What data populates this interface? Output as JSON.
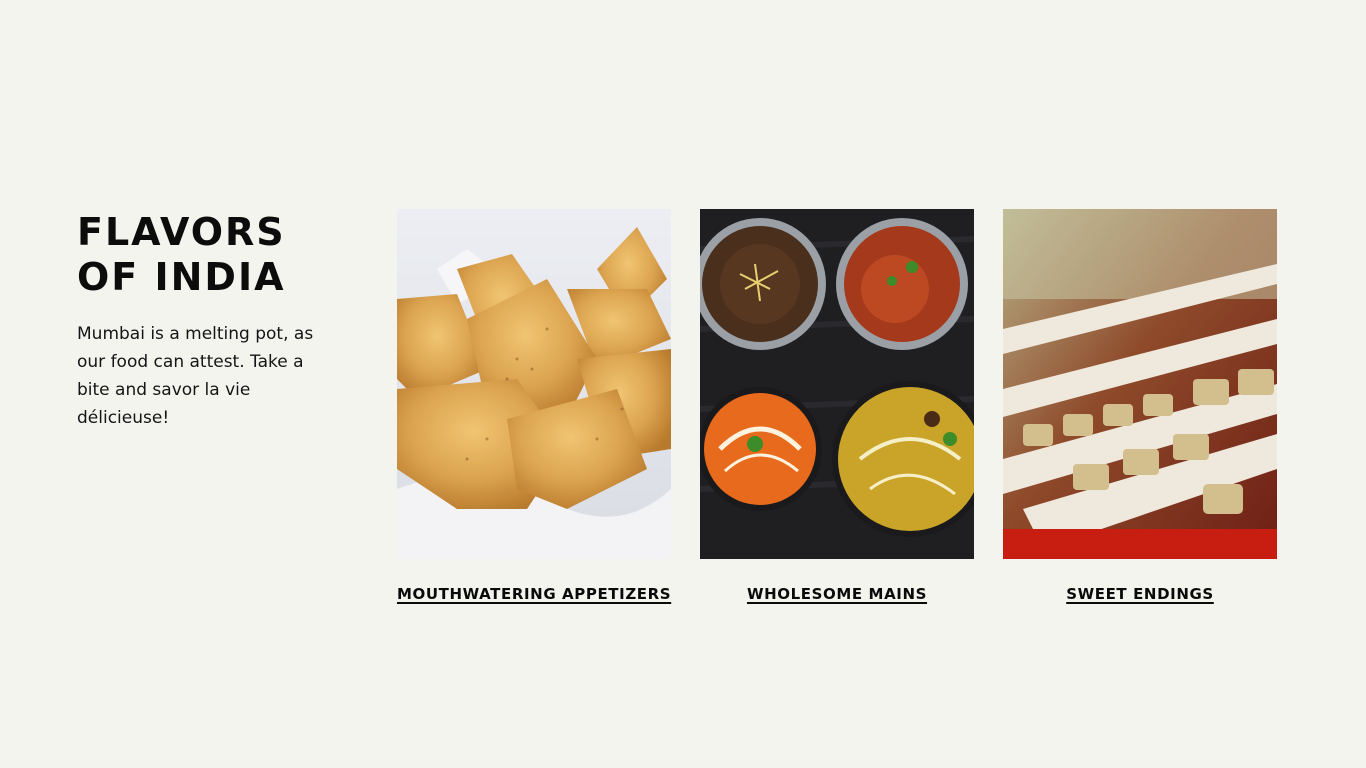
{
  "intro": {
    "title_line1": "FLAVORS",
    "title_line2": "OF INDIA",
    "description": "Mumbai is a melting pot, as our food can attest. Take a bite and savor la vie délicieuse!"
  },
  "cards": [
    {
      "caption": "MOUTHWATERING APPETIZERS",
      "image": "samosas-photo"
    },
    {
      "caption": "WHOLESOME MAINS",
      "image": "curries-photo"
    },
    {
      "caption": "SWEET ENDINGS",
      "image": "sweets-photo"
    }
  ],
  "colors": {
    "background": "#f4f4ef",
    "text": "#111111"
  }
}
